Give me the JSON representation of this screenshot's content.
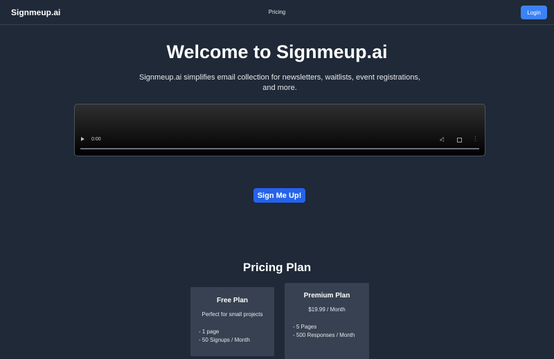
{
  "nav": {
    "brand": "Signmeup.ai",
    "links": [
      "Pricing"
    ],
    "login_label": "Login"
  },
  "hero": {
    "title": "Welcome to Signmeup.ai",
    "subtitle": "Signmeup.ai simplifies email collection for newsletters, waitlists, event registrations, and more."
  },
  "video": {
    "time": "0:00",
    "progress": 0,
    "icons": [
      "play-icon",
      "mute-icon",
      "fullscreen-icon",
      "more-options-icon"
    ]
  },
  "cta": {
    "label": "Sign Me Up!"
  },
  "pricing": {
    "title": "Pricing Plan",
    "plans": [
      {
        "name": "Free Plan",
        "description": "Perfect for small projects",
        "features": [
          "- 1 page",
          "- 50 Signups / Month"
        ]
      },
      {
        "name": "Premium Plan",
        "description": "$19.99 / Month",
        "features": [
          "- 5 Pages",
          "- 500 Responses / Month"
        ]
      }
    ]
  },
  "colors": {
    "background": "#1f2937",
    "card": "#374151",
    "accent": "#3b82f6",
    "cta": "#2563eb"
  }
}
